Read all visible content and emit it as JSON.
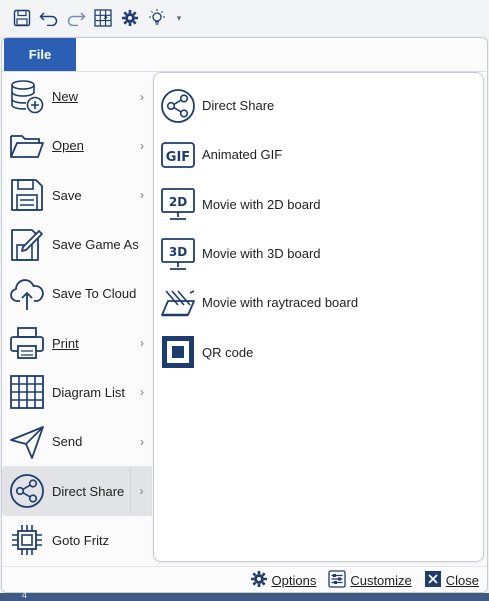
{
  "colors": {
    "accent": "#2b5fb3",
    "icon": "#1e3c6e",
    "file_tab_text": "#ffffff"
  },
  "qat": {
    "icons": [
      "save-icon",
      "undo-icon",
      "redo-icon",
      "board-icon",
      "settings-gear-icon",
      "bulb-icon",
      "qat-dropdown-icon"
    ]
  },
  "file_tab": {
    "label": "File"
  },
  "menu": {
    "items": [
      {
        "id": "new",
        "label": "New",
        "icon": "database-add-icon",
        "submenu": true
      },
      {
        "id": "open",
        "label": "Open",
        "icon": "folder-open-icon",
        "submenu": true
      },
      {
        "id": "save",
        "label": "Save",
        "icon": "floppy-disk-icon",
        "submenu": true
      },
      {
        "id": "save-game-as",
        "label": "Save Game As",
        "icon": "save-as-icon",
        "submenu": false
      },
      {
        "id": "save-to-cloud",
        "label": "Save To Cloud",
        "icon": "cloud-upload-icon",
        "submenu": false
      },
      {
        "id": "print",
        "label": "Print",
        "icon": "printer-icon",
        "submenu": true
      },
      {
        "id": "diagram-list",
        "label": "Diagram List",
        "icon": "grid-icon",
        "submenu": true
      },
      {
        "id": "send",
        "label": "Send",
        "icon": "paper-plane-icon",
        "submenu": true
      },
      {
        "id": "direct-share",
        "label": "Direct Share",
        "icon": "share-icon",
        "submenu": true,
        "active": true
      },
      {
        "id": "goto-fritz",
        "label": "Goto Fritz",
        "icon": "chip-icon",
        "submenu": false
      }
    ]
  },
  "submenu": {
    "items": [
      {
        "label": "Direct Share",
        "icon": "share-icon"
      },
      {
        "label": "Animated GIF",
        "icon": "gif-icon"
      },
      {
        "label": "Movie with 2D board",
        "icon": "monitor-2d-icon"
      },
      {
        "label": "Movie with 3D board",
        "icon": "monitor-3d-icon"
      },
      {
        "label": "Movie with raytraced board",
        "icon": "raytraced-board-icon"
      },
      {
        "label": "QR code",
        "icon": "qr-code-icon"
      }
    ]
  },
  "bottom": {
    "options": "Options",
    "customize": "Customize",
    "close": "Close"
  },
  "background": {
    "number": "4"
  }
}
